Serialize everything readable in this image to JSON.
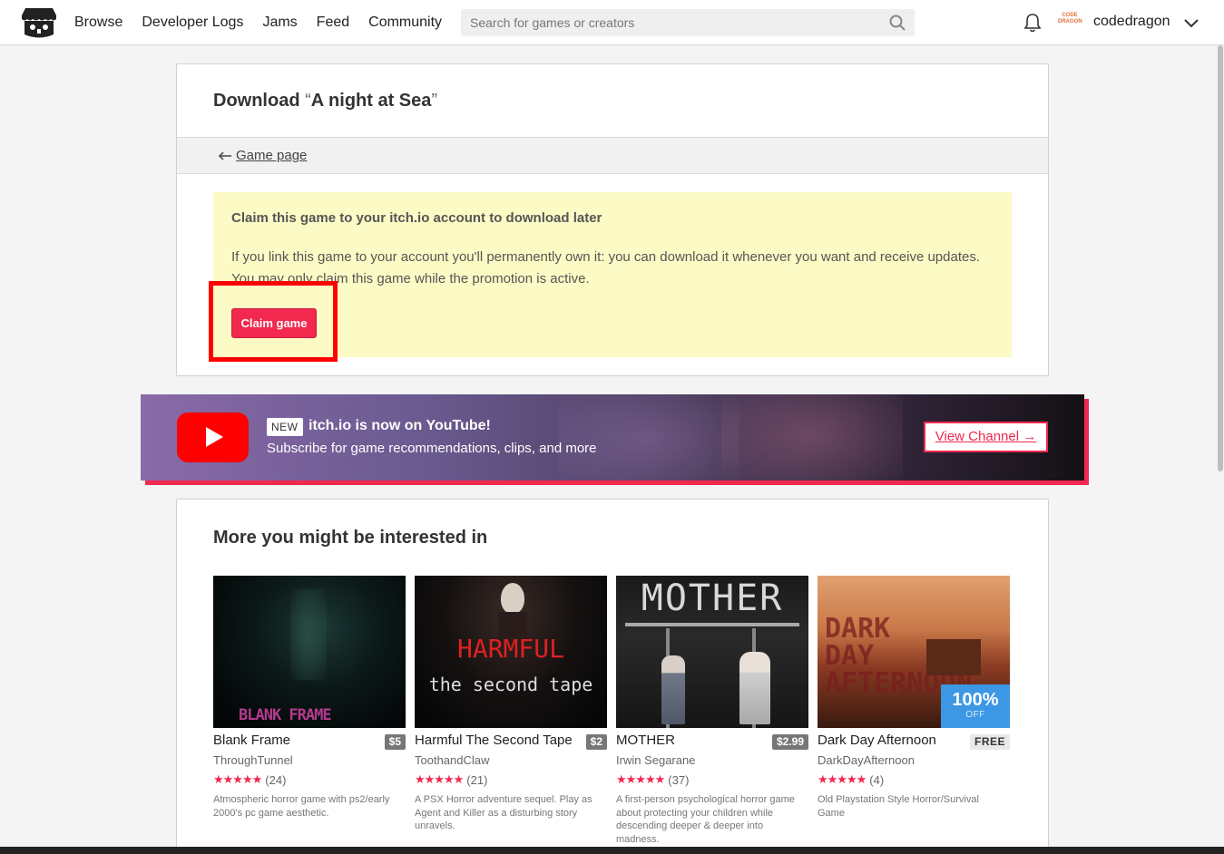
{
  "header": {
    "nav": [
      "Browse",
      "Developer Logs",
      "Jams",
      "Feed",
      "Community"
    ],
    "search_placeholder": "Search for games or creators",
    "username": "codedragon",
    "avatar_text": "CODE DRAGON",
    "icons": [
      "itchio-logo-icon",
      "search-icon",
      "bell-icon",
      "chevron-down-icon"
    ]
  },
  "download": {
    "title_prefix": "Download ",
    "open_quote": "“",
    "game_name": "A night at Sea",
    "close_quote": "”",
    "back_label": "Game page",
    "claim_heading": "Claim this game to your itch.io account to download later",
    "claim_text": "If you link this game to your account you'll permanently own it: you can download it whenever you want and receive updates. You may only claim this game while the promotion is active.",
    "claim_button": "Claim game"
  },
  "youtube": {
    "badge": "NEW",
    "title": "itch.io is now on YouTube!",
    "subtitle": "Subscribe for game recommendations, clips, and more",
    "button": "View Channel →"
  },
  "more": {
    "title": "More you might be interested in",
    "games": [
      {
        "title": "Blank Frame",
        "price": "$5",
        "author": "ThroughTunnel",
        "stars": "★★★★★",
        "count": "(24)",
        "desc": "Atmospheric horror game with ps2/early 2000's pc game aesthetic.",
        "thumb_text": "BLANK FRAME"
      },
      {
        "title": "Harmful The Second Tape",
        "price": "$2",
        "author": "ToothandClaw",
        "stars": "★★★★★",
        "count": "(21)",
        "desc": "A PSX Horror adventure sequel. Play as Agent and Killer as a disturbing story unravels.",
        "thumb_text": "HARMFUL",
        "thumb_sub": "the second tape"
      },
      {
        "title": "MOTHER",
        "price": "$2.99",
        "author": "Irwin Segarane",
        "stars": "★★★★★",
        "count": "(37)",
        "desc": "A first-person psychological horror game about protecting your children while descending deeper & deeper into madness.",
        "thumb_text": "MOTHER"
      },
      {
        "title": "Dark Day Afternoon",
        "price": "FREE",
        "author": "DarkDayAfternoon",
        "stars": "★★★★★",
        "count": "(4)",
        "desc": "Old Playstation Style Horror/Survival Game",
        "thumb_text": "DARK DAY AFTERNOON",
        "sale_pct": "100%",
        "sale_off": "OFF"
      }
    ]
  },
  "colors": {
    "accent": "#f2284f",
    "highlight": "#ff0000",
    "sale": "#3c98e4",
    "claim_bg": "#fcfbc5"
  }
}
